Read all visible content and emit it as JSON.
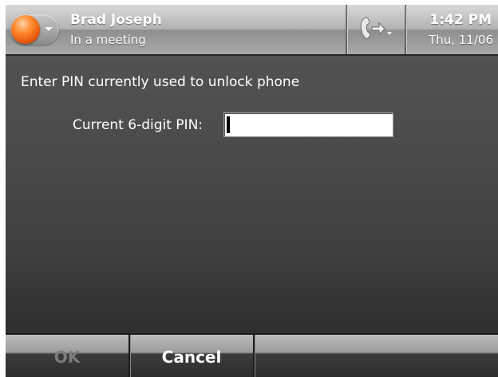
{
  "status_bar": {
    "user_name": "Brad Joseph",
    "presence_status": "In a meeting",
    "presence_color": "#ff7a1f",
    "call_forward_icon": "call-forward-icon",
    "time": "1:42 PM",
    "date": "Thu, 11/06"
  },
  "dialog": {
    "instruction": "Enter PIN currently used to unlock phone",
    "pin_label": "Current 6-digit PIN:",
    "pin_value": ""
  },
  "softkeys": {
    "left_label": "OK",
    "left_enabled": false,
    "right_label": "Cancel"
  }
}
